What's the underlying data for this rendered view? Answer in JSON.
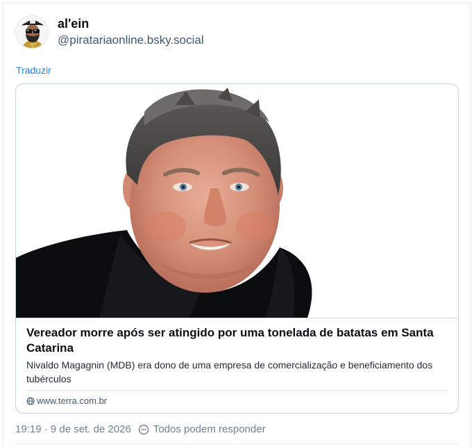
{
  "author": {
    "display_name": "al'ein",
    "handle": "@piratariaonline.bsky.social"
  },
  "translate_label": "Traduzir",
  "link_card": {
    "title": "Vereador morre após ser atingido por uma tonelada de batatas em Santa Catarina",
    "description": "Nivaldo Magagnin (MDB) era dono de uma empresa de comercialização e beneficiamento dos tubérculos",
    "domain": "www.terra.com.br"
  },
  "post_meta": {
    "timestamp": "19:19 · 9 de set. de 2026",
    "reply_setting": "Todos podem responder"
  },
  "icons": {
    "globe": "globe-icon",
    "reply_setting": "chat-bubble-icon"
  },
  "colors": {
    "link": "#1083fe",
    "handle": "#42576c",
    "meta": "#6f8194",
    "border": "#c9d1da"
  }
}
